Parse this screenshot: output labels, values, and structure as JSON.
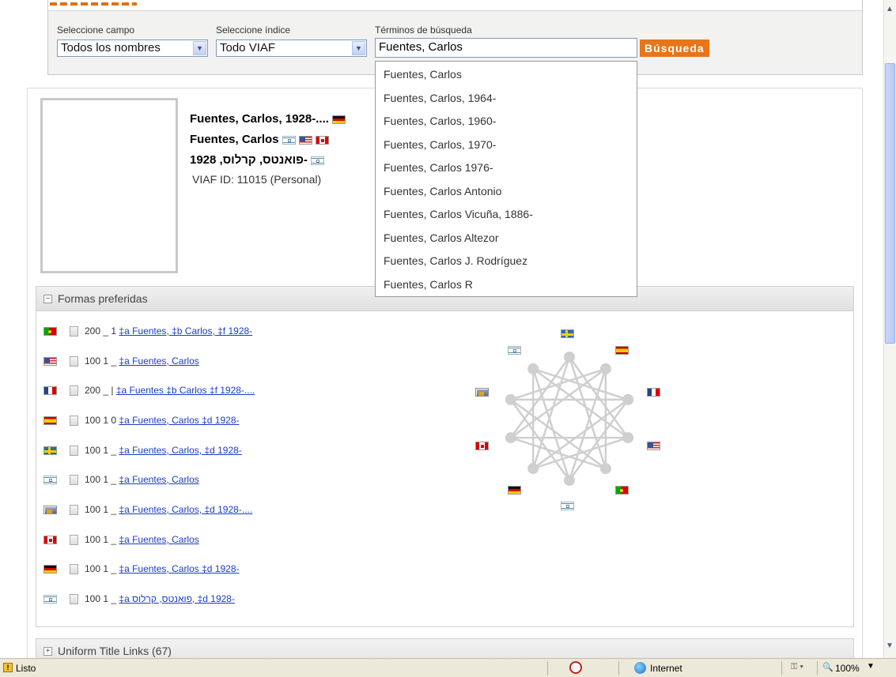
{
  "search": {
    "field_label": "Seleccione campo",
    "field_value": "Todos los nombres",
    "index_label": "Seleccione índice",
    "index_value": "Todo VIAF",
    "terms_label": "Términos de búsqueda",
    "terms_value": "Fuentes, Carlos",
    "button_label": "Búsqueda",
    "suggestions": [
      "Fuentes, Carlos",
      "Fuentes, Carlos, 1964-",
      "Fuentes, Carlos, 1960-",
      "Fuentes, Carlos, 1970-",
      "Fuentes, Carlos 1976-",
      "Fuentes, Carlos Antonio",
      "Fuentes, Carlos Vicuña, 1886-",
      "Fuentes, Carlos Altezor",
      "Fuentes, Carlos J. Rodríguez",
      "Fuentes, Carlos R"
    ]
  },
  "record": {
    "headings": [
      {
        "text": "Fuentes, Carlos, 1928-....",
        "flags": [
          "de"
        ]
      },
      {
        "text": "Fuentes, Carlos",
        "flags": [
          "il",
          "us",
          "ca"
        ]
      },
      {
        "text": "פואנטס, קרלוס, 1928-",
        "flags": [
          "il"
        ]
      }
    ],
    "viaf_id": "VIAF ID: 11015 (Personal)"
  },
  "preferred_forms": {
    "title": "Formas preferidas",
    "rows": [
      {
        "flag": "pt",
        "code": "200 _ 1",
        "link": "‡a Fuentes, ‡b Carlos, ‡f 1928-"
      },
      {
        "flag": "us",
        "code": "100 1 _",
        "link": "‡a Fuentes, Carlos"
      },
      {
        "flag": "fr",
        "code": "200 _ |",
        "link": "‡a Fuentes ‡b Carlos ‡f 1928-...."
      },
      {
        "flag": "es",
        "code": "100 1 0",
        "link": "‡a Fuentes, Carlos ‡d 1928-"
      },
      {
        "flag": "se",
        "code": "100 1 _",
        "link": "‡a Fuentes, Carlos, ‡d 1928-"
      },
      {
        "flag": "il",
        "code": "100 1 _",
        "link": "‡a Fuentes, Carlos"
      },
      {
        "flag": "lib",
        "code": "100 1 _",
        "link": "‡a Fuentes, Carlos, ‡d 1928-...."
      },
      {
        "flag": "ca",
        "code": "100 1 _",
        "link": "‡a Fuentes, Carlos"
      },
      {
        "flag": "de",
        "code": "100 1 _",
        "link": "‡a Fuentes, Carlos ‡d 1928-"
      },
      {
        "flag": "il",
        "code": "100 1 _",
        "link": "‡a פואנטס, קרלוס, ‡d 1928-"
      }
    ],
    "graph_nodes": [
      "se",
      "es",
      "fr",
      "us",
      "pt",
      "il",
      "de",
      "ca",
      "lib",
      "il"
    ]
  },
  "uniform_panel": {
    "title": "Uniform Title Links (67)"
  },
  "status": {
    "left": "Listo",
    "zone": "Internet",
    "zoom": "100%"
  },
  "colors": {
    "accent": "#e87517",
    "link": "#1a3cc8"
  }
}
